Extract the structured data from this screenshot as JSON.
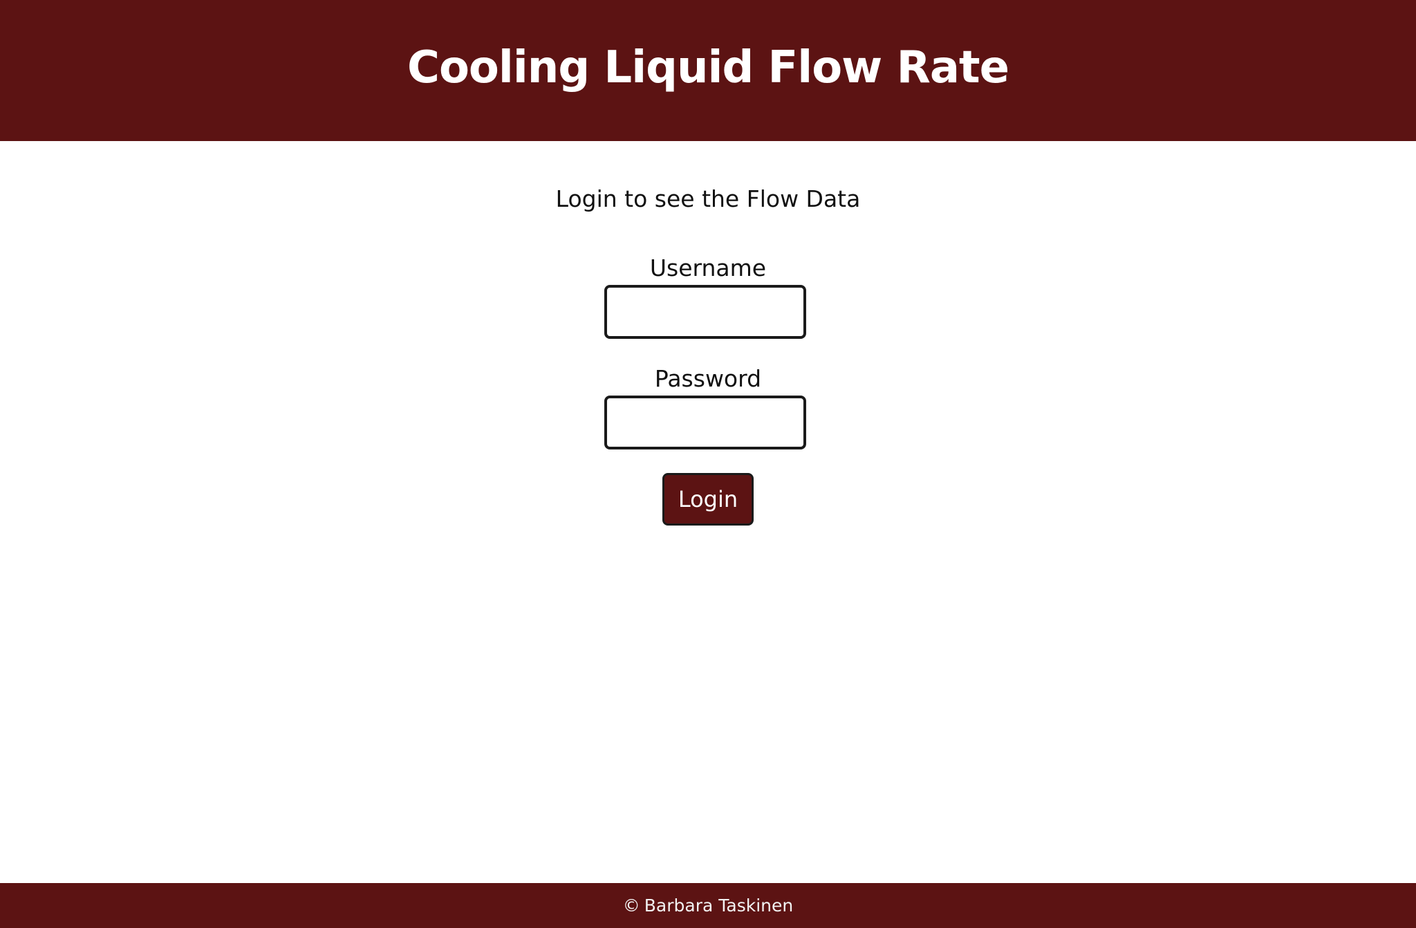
{
  "header": {
    "title": "Cooling Liquid Flow Rate"
  },
  "main": {
    "intro_text": "Login to see the Flow Data",
    "username_label": "Username",
    "username_value": "",
    "password_label": "Password",
    "password_value": "",
    "login_button_label": "Login"
  },
  "footer": {
    "copyright_symbol": "©",
    "author": "Barbara Taskinen"
  },
  "colors": {
    "brand": "#5c1313",
    "background": "#ffffff",
    "border": "#1a1a1a"
  }
}
